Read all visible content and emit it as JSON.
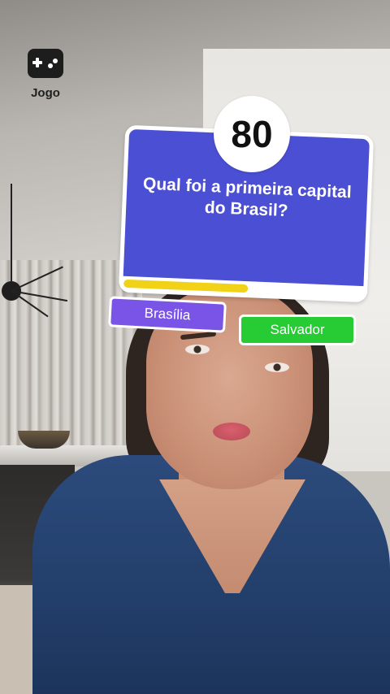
{
  "game": {
    "label": "Jogo",
    "icon": "gamepad-icon"
  },
  "quiz": {
    "score": "80",
    "question": "Qual foi a primeira capital do Brasil?",
    "timer_fraction": 0.52,
    "answers": [
      {
        "label": "Brasília",
        "color": "#7a54e6"
      },
      {
        "label": "Salvador",
        "color": "#27cc34"
      }
    ]
  },
  "colors": {
    "card": "#4b4fd4",
    "timer": "#f2d216"
  }
}
